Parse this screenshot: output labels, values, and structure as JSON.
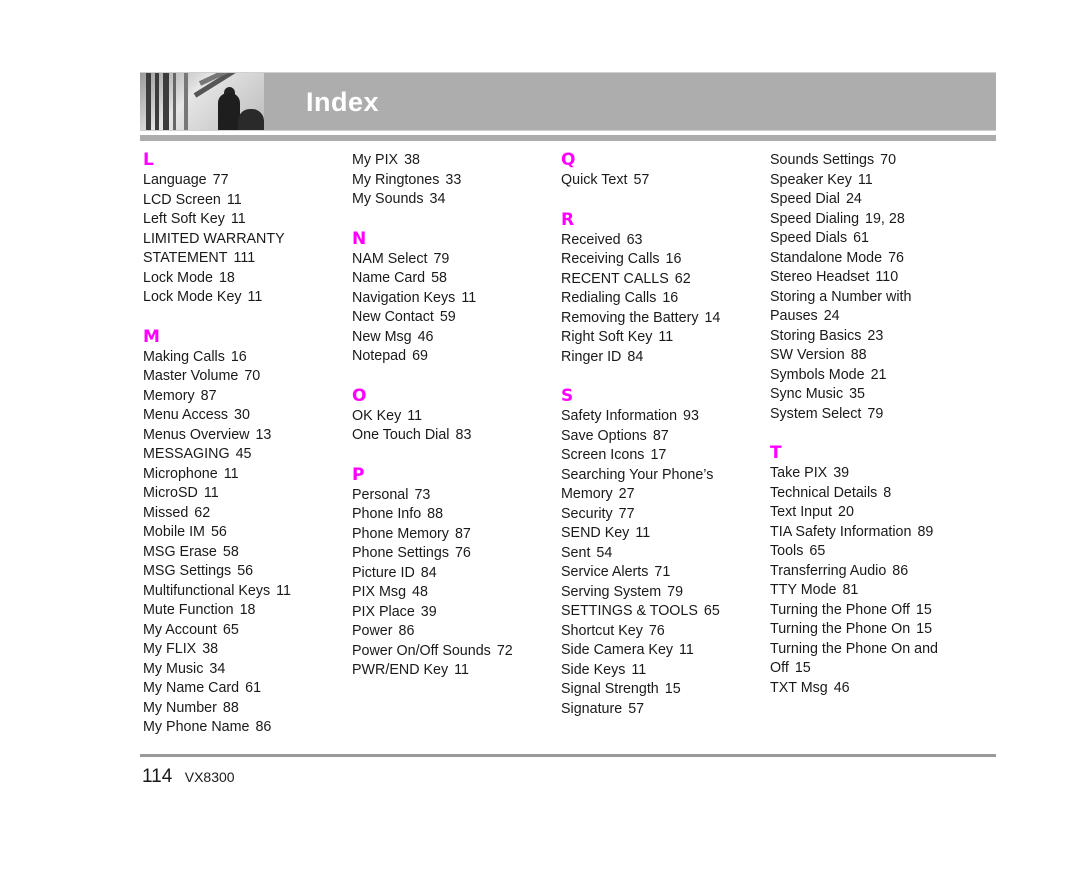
{
  "header": {
    "title": "Index"
  },
  "columns": [
    {
      "sections": [
        {
          "letter": "L",
          "entries": [
            {
              "text": "Language",
              "page": "77"
            },
            {
              "text": "LCD Screen",
              "page": "11"
            },
            {
              "text": "Left Soft Key",
              "page": "11"
            },
            {
              "text": "LIMITED WARRANTY",
              "page": ""
            },
            {
              "text": "STATEMENT",
              "page": "111"
            },
            {
              "text": "Lock Mode",
              "page": "18"
            },
            {
              "text": "Lock Mode Key",
              "page": "11"
            }
          ]
        },
        {
          "letter": "M",
          "entries": [
            {
              "text": "Making Calls",
              "page": "16"
            },
            {
              "text": "Master Volume",
              "page": "70"
            },
            {
              "text": "Memory",
              "page": "87"
            },
            {
              "text": "Menu Access",
              "page": "30"
            },
            {
              "text": "Menus Overview",
              "page": "13"
            },
            {
              "text": "MESSAGING",
              "page": "45"
            },
            {
              "text": "Microphone",
              "page": "11"
            },
            {
              "text": "MicroSD",
              "page": "11"
            },
            {
              "text": "Missed",
              "page": "62"
            },
            {
              "text": "Mobile IM",
              "page": "56"
            },
            {
              "text": "MSG Erase",
              "page": "58"
            },
            {
              "text": "MSG Settings",
              "page": "56"
            },
            {
              "text": "Multifunctional Keys",
              "page": "11"
            },
            {
              "text": "Mute Function",
              "page": "18"
            },
            {
              "text": "My Account",
              "page": "65"
            },
            {
              "text": "My FLIX",
              "page": "38"
            },
            {
              "text": "My Music",
              "page": "34"
            },
            {
              "text": "My Name Card",
              "page": "61"
            },
            {
              "text": "My Number",
              "page": "88"
            },
            {
              "text": "My Phone Name",
              "page": "86"
            }
          ]
        }
      ]
    },
    {
      "sections": [
        {
          "letter": "",
          "entries": [
            {
              "text": "My PIX",
              "page": "38"
            },
            {
              "text": "My Ringtones",
              "page": "33"
            },
            {
              "text": "My Sounds",
              "page": "34"
            }
          ]
        },
        {
          "letter": "N",
          "entries": [
            {
              "text": "NAM Select",
              "page": "79"
            },
            {
              "text": "Name Card",
              "page": "58"
            },
            {
              "text": "Navigation Keys",
              "page": "11"
            },
            {
              "text": "New Contact",
              "page": "59"
            },
            {
              "text": "New Msg",
              "page": "46"
            },
            {
              "text": "Notepad",
              "page": "69"
            }
          ]
        },
        {
          "letter": "O",
          "entries": [
            {
              "text": "OK Key",
              "page": "11"
            },
            {
              "text": "One Touch Dial",
              "page": "83"
            }
          ]
        },
        {
          "letter": "P",
          "entries": [
            {
              "text": "Personal",
              "page": "73"
            },
            {
              "text": "Phone Info",
              "page": "88"
            },
            {
              "text": "Phone Memory",
              "page": "87"
            },
            {
              "text": "Phone Settings",
              "page": "76"
            },
            {
              "text": "Picture ID",
              "page": "84"
            },
            {
              "text": "PIX Msg",
              "page": "48"
            },
            {
              "text": "PIX Place",
              "page": "39"
            },
            {
              "text": "Power",
              "page": "86"
            },
            {
              "text": "Power On/Off Sounds",
              "page": "72"
            },
            {
              "text": "PWR/END Key",
              "page": "11"
            }
          ]
        }
      ]
    },
    {
      "sections": [
        {
          "letter": "Q",
          "entries": [
            {
              "text": "Quick Text",
              "page": "57"
            }
          ]
        },
        {
          "letter": "R",
          "entries": [
            {
              "text": "Received",
              "page": "63"
            },
            {
              "text": "Receiving Calls",
              "page": "16"
            },
            {
              "text": "RECENT CALLS",
              "page": "62"
            },
            {
              "text": "Redialing Calls",
              "page": "16"
            },
            {
              "text": "Removing the Battery",
              "page": "14"
            },
            {
              "text": "Right Soft Key",
              "page": "11"
            },
            {
              "text": "Ringer ID",
              "page": "84"
            }
          ]
        },
        {
          "letter": "S",
          "entries": [
            {
              "text": "Safety Information",
              "page": "93"
            },
            {
              "text": "Save Options",
              "page": "87"
            },
            {
              "text": "Screen Icons",
              "page": "17"
            },
            {
              "text": "Searching Your Phone’s",
              "page": ""
            },
            {
              "text": "Memory",
              "page": "27"
            },
            {
              "text": "Security",
              "page": "77"
            },
            {
              "text": "SEND Key",
              "page": "11"
            },
            {
              "text": "Sent",
              "page": "54"
            },
            {
              "text": "Service Alerts",
              "page": "71"
            },
            {
              "text": "Serving System",
              "page": "79"
            },
            {
              "text": "SETTINGS & TOOLS",
              "page": "65"
            },
            {
              "text": "Shortcut Key",
              "page": "76"
            },
            {
              "text": "Side Camera Key",
              "page": "11"
            },
            {
              "text": "Side Keys",
              "page": "11"
            },
            {
              "text": "Signal Strength",
              "page": "15"
            },
            {
              "text": "Signature",
              "page": "57"
            }
          ]
        }
      ]
    },
    {
      "sections": [
        {
          "letter": "",
          "entries": [
            {
              "text": "Sounds Settings",
              "page": "70"
            },
            {
              "text": "Speaker Key",
              "page": "11"
            },
            {
              "text": "Speed Dial",
              "page": "24"
            },
            {
              "text": "Speed Dialing",
              "page": "19, 28"
            },
            {
              "text": "Speed Dials",
              "page": "61"
            },
            {
              "text": "Standalone Mode",
              "page": "76"
            },
            {
              "text": "Stereo Headset",
              "page": "110"
            },
            {
              "text": "Storing a Number with",
              "page": ""
            },
            {
              "text": "Pauses",
              "page": "24"
            },
            {
              "text": "Storing Basics",
              "page": "23"
            },
            {
              "text": "SW Version",
              "page": "88"
            },
            {
              "text": "Symbols Mode",
              "page": "21"
            },
            {
              "text": "Sync Music",
              "page": "35"
            },
            {
              "text": "System Select",
              "page": "79"
            }
          ]
        },
        {
          "letter": "T",
          "entries": [
            {
              "text": "Take PIX",
              "page": "39"
            },
            {
              "text": "Technical Details",
              "page": "8"
            },
            {
              "text": "Text Input",
              "page": "20"
            },
            {
              "text": "TIA Safety Information",
              "page": "89"
            },
            {
              "text": "Tools",
              "page": "65"
            },
            {
              "text": "Transferring Audio",
              "page": "86"
            },
            {
              "text": "TTY Mode",
              "page": "81"
            },
            {
              "text": "Turning the Phone Off",
              "page": "15"
            },
            {
              "text": "Turning the Phone On",
              "page": "15"
            },
            {
              "text": "Turning the Phone On and",
              "page": ""
            },
            {
              "text": "Off",
              "page": "15"
            },
            {
              "text": "TXT Msg",
              "page": "46"
            }
          ]
        }
      ]
    }
  ],
  "footer": {
    "page_number": "114",
    "model": "VX8300"
  },
  "colors": {
    "letter_accent": "#ff00ff",
    "header_bg": "#adadad"
  }
}
